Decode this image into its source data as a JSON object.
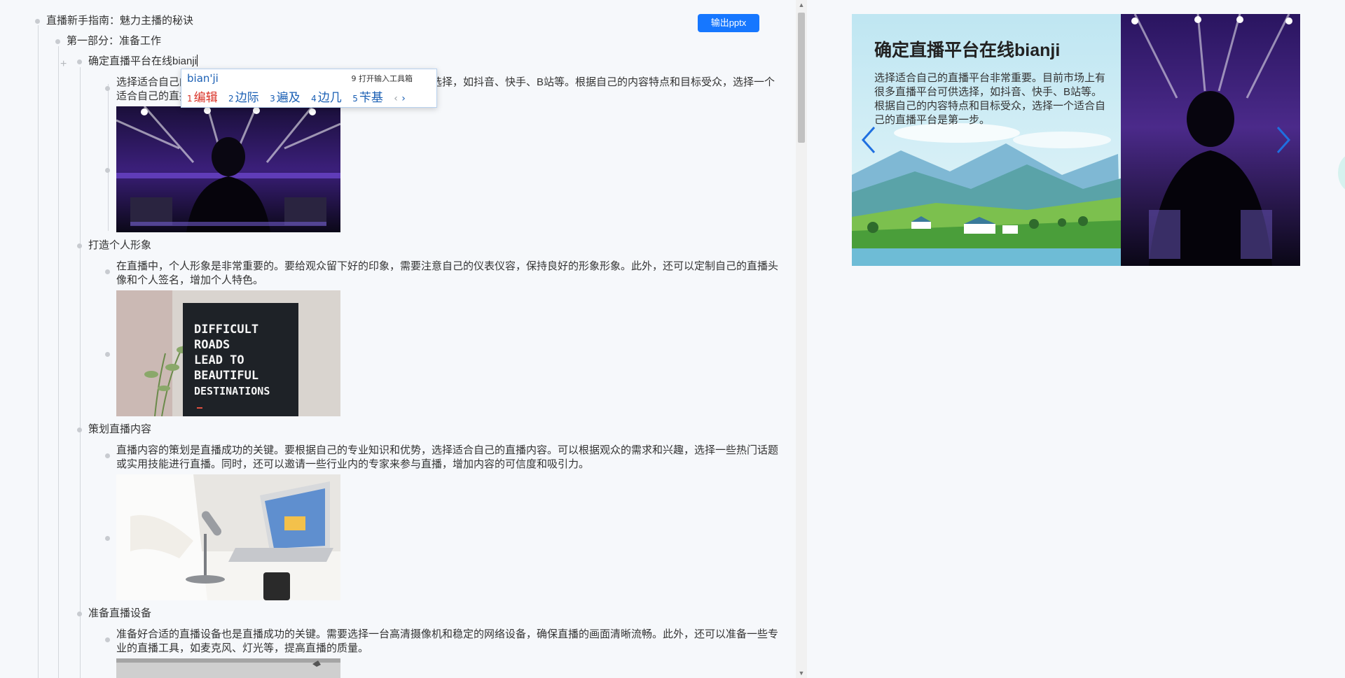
{
  "outline": {
    "root": "直播新手指南：魅力主播的秘诀",
    "part1": "第一部分：准备工作",
    "node1": {
      "title": "确定直播平台在线bianji",
      "text": "选择适合自己的直播平台非常重要。目前市场上有很多直播平台可供选择，如抖音、快手、B站等。根据自己的内容特点和目标受众，选择一个适合自己的直播平台是第一步。"
    },
    "node2": {
      "title": "打造个人形象",
      "text": "在直播中，个人形象是非常重要的。要给观众留下好的印象，需要注意自己的仪表仪容，保持良好的形象形象。此外，还可以定制自己的直播头像和个人签名，增加个人特色。"
    },
    "node3": {
      "title": "策划直播内容",
      "text": "直播内容的策划是直播成功的关键。要根据自己的专业知识和优势，选择适合自己的直播内容。可以根据观众的需求和兴趣，选择一些热门话题或实用技能进行直播。同时，还可以邀请一些行业内的专家来参与直播，增加内容的可信度和吸引力。"
    },
    "node4": {
      "title": "准备直播设备",
      "text": "准备好合适的直播设备也是直播成功的关键。需要选择一台高清摄像机和稳定的网络设备，确保直播的画面清晰流畅。此外，还可以准备一些专业的直播工具，如麦克风、灯光等，提高直播的质量。"
    },
    "sign_lines": [
      "DIFFICULT",
      "ROADS",
      "LEAD TO",
      "BEAUTIFUL",
      "DESTINATIONS"
    ]
  },
  "toolbar": {
    "export_label": "输出pptx"
  },
  "ime": {
    "input": "bian'ji",
    "tool": "9 打开输入工具箱",
    "candidates": [
      {
        "num": "1",
        "text": "编辑"
      },
      {
        "num": "2",
        "text": "边际"
      },
      {
        "num": "3",
        "text": "遍及"
      },
      {
        "num": "4",
        "text": "边几"
      },
      {
        "num": "5",
        "text": "苄基"
      }
    ],
    "prev": "‹",
    "next": "›"
  },
  "preview": {
    "title": "确定直播平台在线bianji",
    "body": "选择适合自己的直播平台非常重要。目前市场上有很多直播平台可供选择，如抖音、快手、B站等。根据自己的内容特点和目标受众，选择一个适合自己的直播平台是第一步。"
  },
  "colors": {
    "accent": "#1677ff",
    "nav_arrow": "#1f6fe0"
  }
}
